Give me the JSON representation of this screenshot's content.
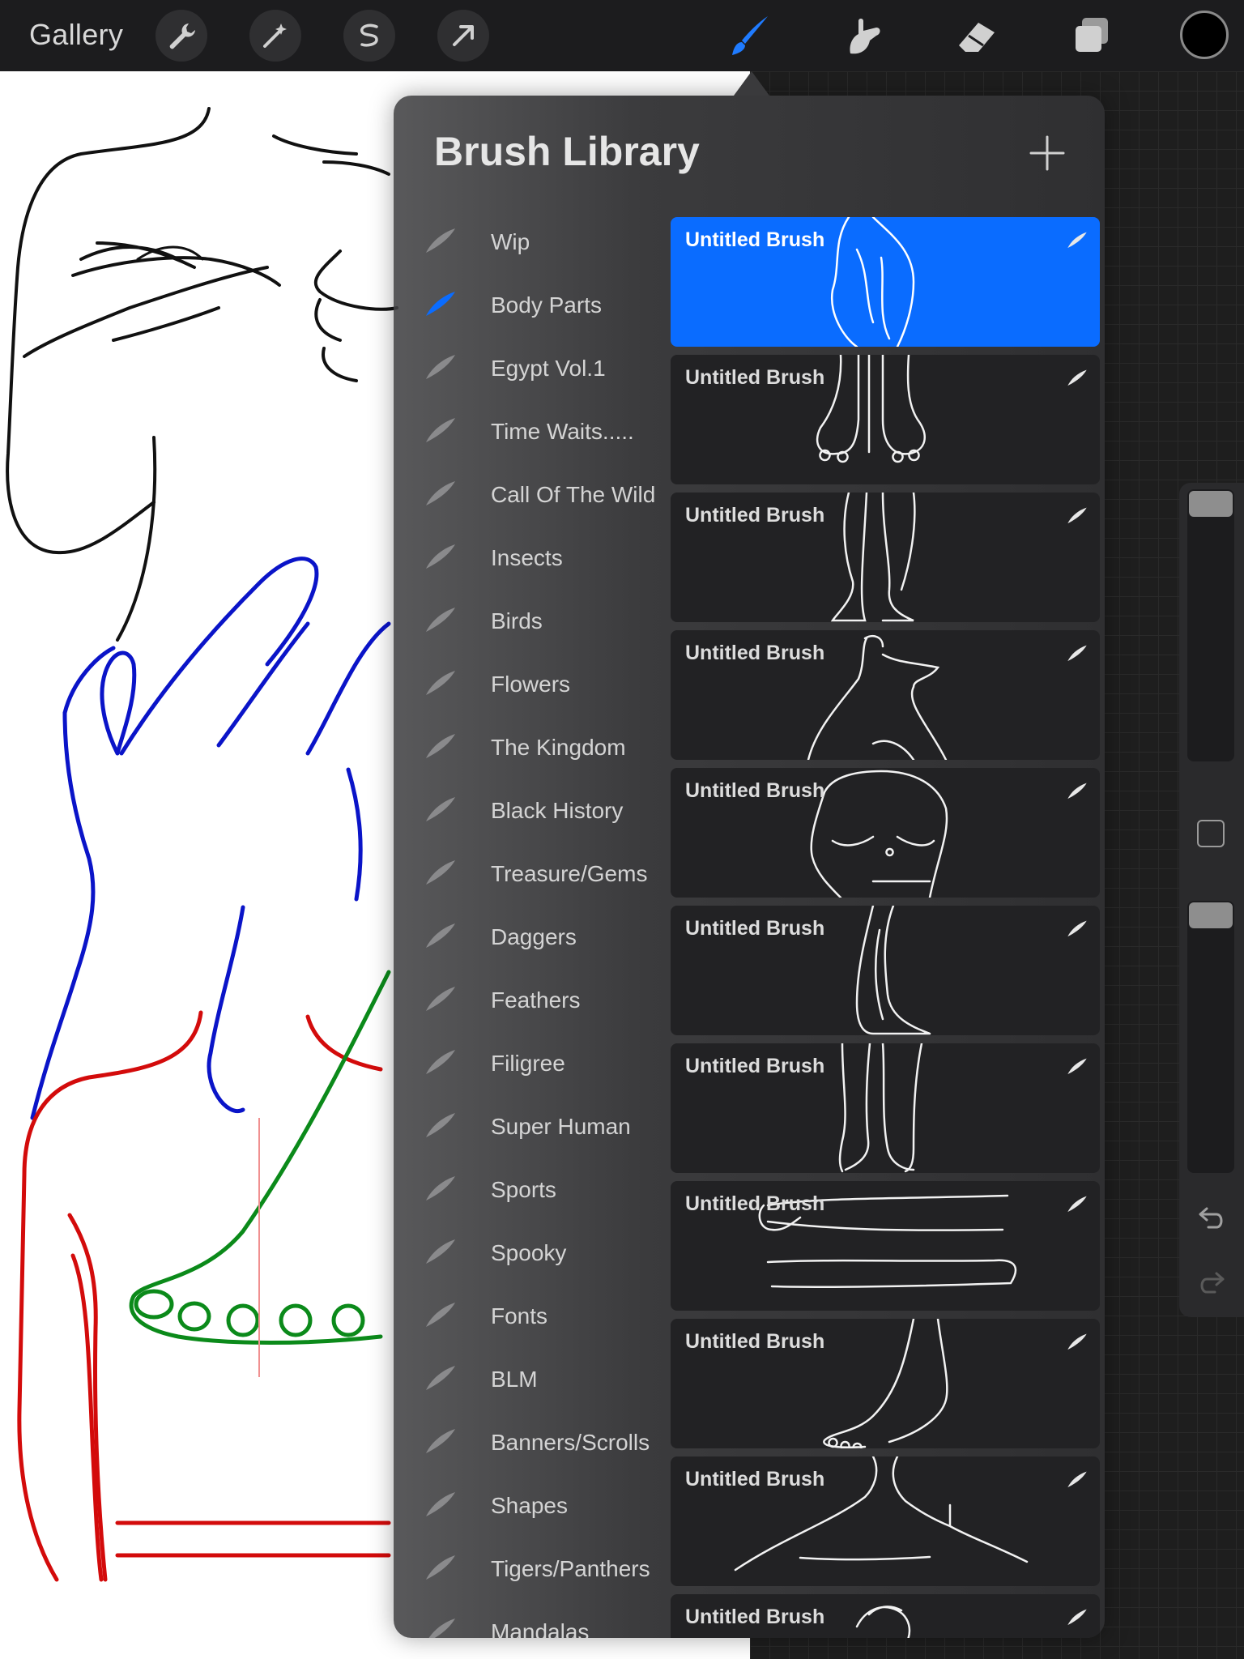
{
  "toolbar": {
    "gallery_label": "Gallery",
    "left_tools": [
      "wrench-icon",
      "magic-wand-icon",
      "selection-icon",
      "transform-arrow-icon"
    ],
    "right_tools": [
      "brush-icon",
      "smudge-icon",
      "eraser-icon",
      "layers-icon"
    ],
    "active_tool": "brush-icon",
    "current_color": "#000000"
  },
  "brush_library": {
    "title": "Brush Library",
    "add_icon": "plus-icon",
    "accent_color": "#0a6cff",
    "selected_set": "Body Parts",
    "sets": [
      {
        "label": "Wip"
      },
      {
        "label": "Body Parts"
      },
      {
        "label": "Egypt Vol.1"
      },
      {
        "label": "Time Waits....."
      },
      {
        "label": "Call Of The Wild"
      },
      {
        "label": "Insects"
      },
      {
        "label": "Birds"
      },
      {
        "label": "Flowers"
      },
      {
        "label": "The Kingdom"
      },
      {
        "label": "Black History"
      },
      {
        "label": "Treasure/Gems"
      },
      {
        "label": "Daggers"
      },
      {
        "label": "Feathers"
      },
      {
        "label": "Filigree"
      },
      {
        "label": "Super Human"
      },
      {
        "label": "Sports"
      },
      {
        "label": "Spooky"
      },
      {
        "label": "Fonts"
      },
      {
        "label": "BLM"
      },
      {
        "label": "Banners/Scrolls"
      },
      {
        "label": "Shapes"
      },
      {
        "label": "Tigers/Panthers"
      },
      {
        "label": "Mandalas"
      }
    ],
    "brushes": [
      {
        "name": "Untitled Brush",
        "preview": "arm-sketch",
        "selected": true
      },
      {
        "name": "Untitled Brush",
        "preview": "feet-pair"
      },
      {
        "name": "Untitled Brush",
        "preview": "legs-front"
      },
      {
        "name": "Untitled Brush",
        "preview": "neck-shoulder"
      },
      {
        "name": "Untitled Brush",
        "preview": "torso"
      },
      {
        "name": "Untitled Brush",
        "preview": "leg-side"
      },
      {
        "name": "Untitled Brush",
        "preview": "legs-back"
      },
      {
        "name": "Untitled Brush",
        "preview": "arms-outstretched"
      },
      {
        "name": "Untitled Brush",
        "preview": "foot"
      },
      {
        "name": "Untitled Brush",
        "preview": "collarbone"
      },
      {
        "name": "Untitled Brush",
        "preview": "pelvis"
      }
    ]
  },
  "side_panel": {
    "brush_size_level": 0.05,
    "opacity_level": 0.05,
    "modify_button": "eyedropper-square-icon",
    "undo_icon": "undo-icon",
    "redo_icon": "redo-icon"
  }
}
